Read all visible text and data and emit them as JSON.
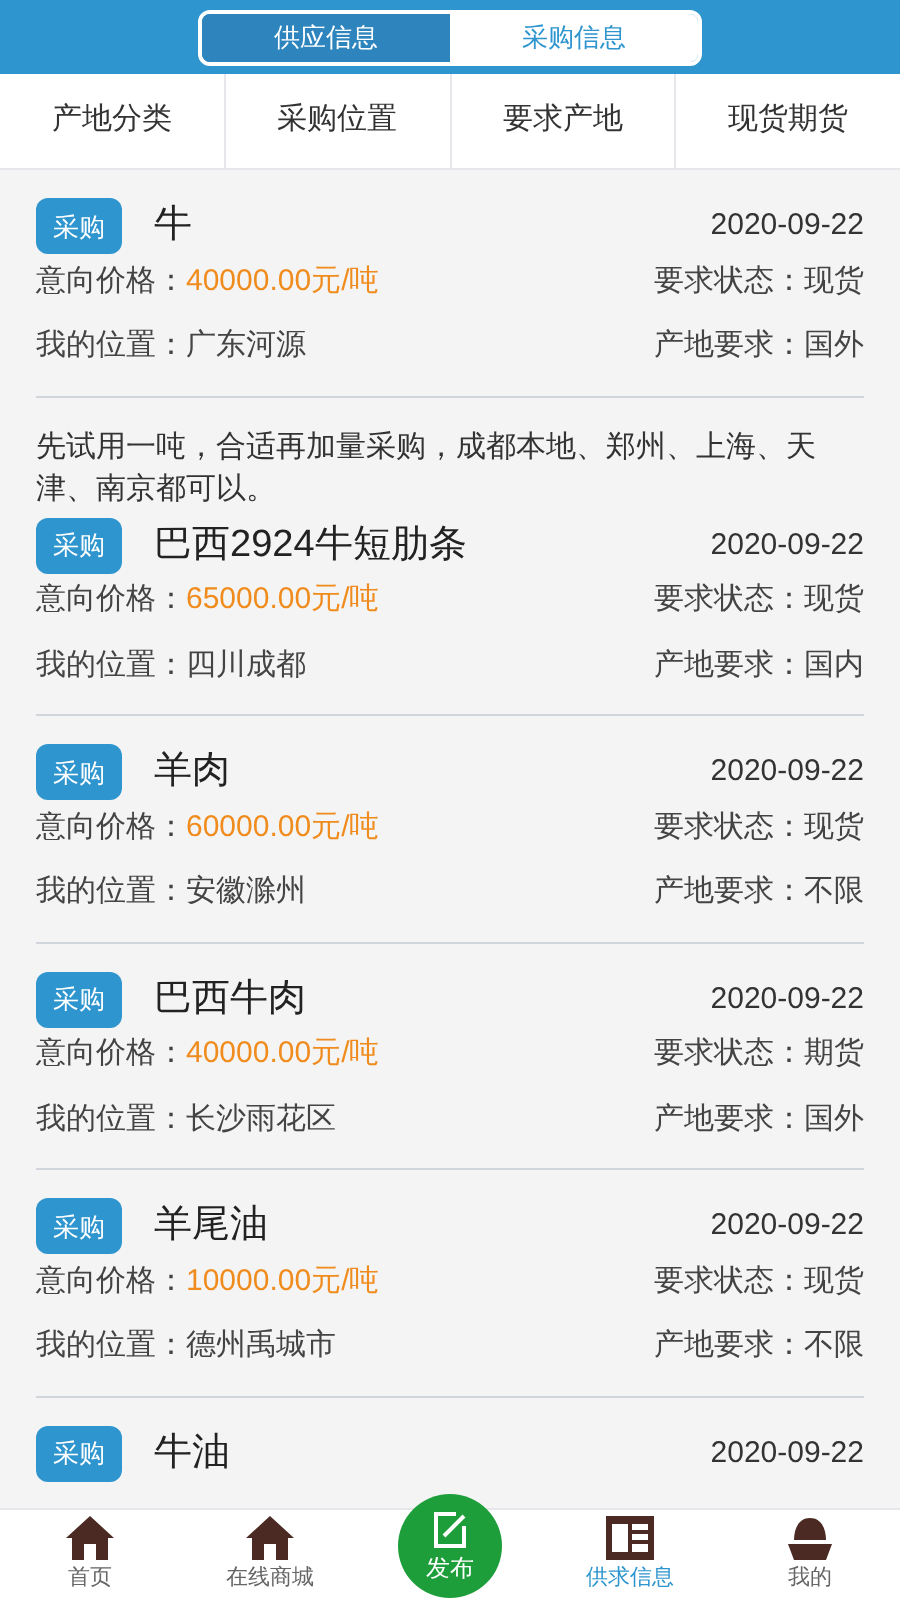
{
  "top_tabs": [
    {
      "label": "供应信息",
      "selected": false
    },
    {
      "label": "采购信息",
      "selected": true
    }
  ],
  "filters": [
    "产地分类",
    "采购位置",
    "要求产地",
    "现货期货"
  ],
  "items": [
    {
      "badge": "采购",
      "title": "牛",
      "date": "2020-09-22",
      "price_label": "意向价格：",
      "price": "40000.00元/吨",
      "status": "要求状态：现货",
      "location": "我的位置：广东河源",
      "origin": "产地要求：国外"
    },
    {
      "note": "先试用一吨，合适再加量采购，成都本地、郑州、上海、天津、南京都可以。",
      "badge": "采购",
      "title": "巴西2924牛短肋条",
      "date": "2020-09-22",
      "price_label": "意向价格：",
      "price": "65000.00元/吨",
      "status": "要求状态：现货",
      "location": "我的位置：四川成都",
      "origin": "产地要求：国内"
    },
    {
      "badge": "采购",
      "title": "羊肉",
      "date": "2020-09-22",
      "price_label": "意向价格：",
      "price": "60000.00元/吨",
      "status": "要求状态：现货",
      "location": "我的位置：安徽滁州",
      "origin": "产地要求：不限"
    },
    {
      "badge": "采购",
      "title": "巴西牛肉",
      "date": "2020-09-22",
      "price_label": "意向价格：",
      "price": "40000.00元/吨",
      "status": "要求状态：期货",
      "location": "我的位置：长沙雨花区",
      "origin": "产地要求：国外"
    },
    {
      "badge": "采购",
      "title": "羊尾油",
      "date": "2020-09-22",
      "price_label": "意向价格：",
      "price": "10000.00元/吨",
      "status": "要求状态：现货",
      "location": "我的位置：德州禹城市",
      "origin": "产地要求：不限"
    },
    {
      "badge": "采购",
      "title": "牛油",
      "date": "2020-09-22"
    }
  ],
  "nav": [
    {
      "kind": "home",
      "label": "首页",
      "selected": false
    },
    {
      "kind": "shop",
      "label": "在线商城",
      "selected": false
    },
    {
      "kind": "publish",
      "label": "发布",
      "selected": false
    },
    {
      "kind": "news",
      "label": "供求信息",
      "selected": true
    },
    {
      "kind": "profile",
      "label": "我的",
      "selected": false
    }
  ]
}
